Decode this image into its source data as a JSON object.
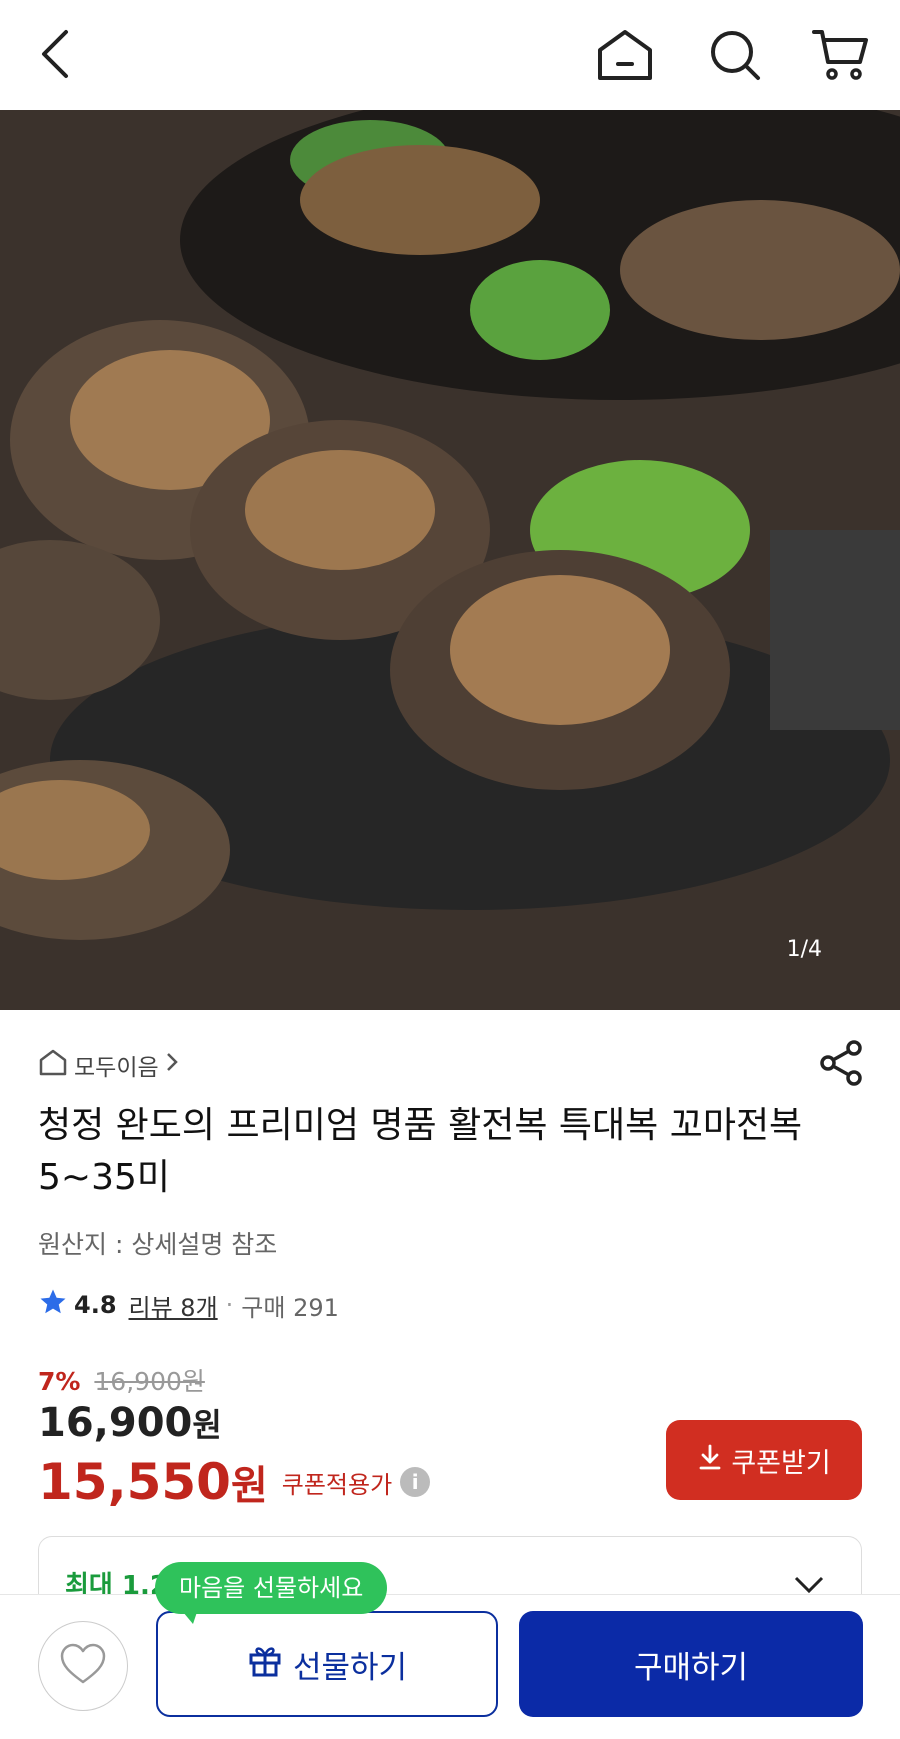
{
  "header": {
    "icons": [
      "back-icon",
      "home-icon",
      "search-icon",
      "cart-icon"
    ]
  },
  "gallery": {
    "counter": "1/4",
    "alt": "전복 상품 이미지"
  },
  "product": {
    "store": "모두이음",
    "title": "청정 완도의 프리미엄 명품 활전복 특대복 꼬마전복 5~35미",
    "origin": "원산지 : 상세설명 참조",
    "rating": "4.8",
    "reviews": "리뷰 8개",
    "separator": "·",
    "purchases": "구매 291",
    "discount": "7%",
    "original_price": "16,900원",
    "price_num": "16,900",
    "price_unit": "원",
    "coupon_price_num": "15,550",
    "coupon_price_unit": "원",
    "coupon_label": "쿠폰적용가",
    "coupon_button": "쿠폰받기",
    "benefit_text": "최대 1.2"
  },
  "bottom": {
    "tooltip": "마음을 선물하세요",
    "gift_label": "선물하기",
    "buy_label": "구매하기"
  },
  "colors": {
    "accent_red": "#d12e21",
    "brand_blue": "#0b2aa7",
    "tooltip_green": "#2fc25b"
  }
}
